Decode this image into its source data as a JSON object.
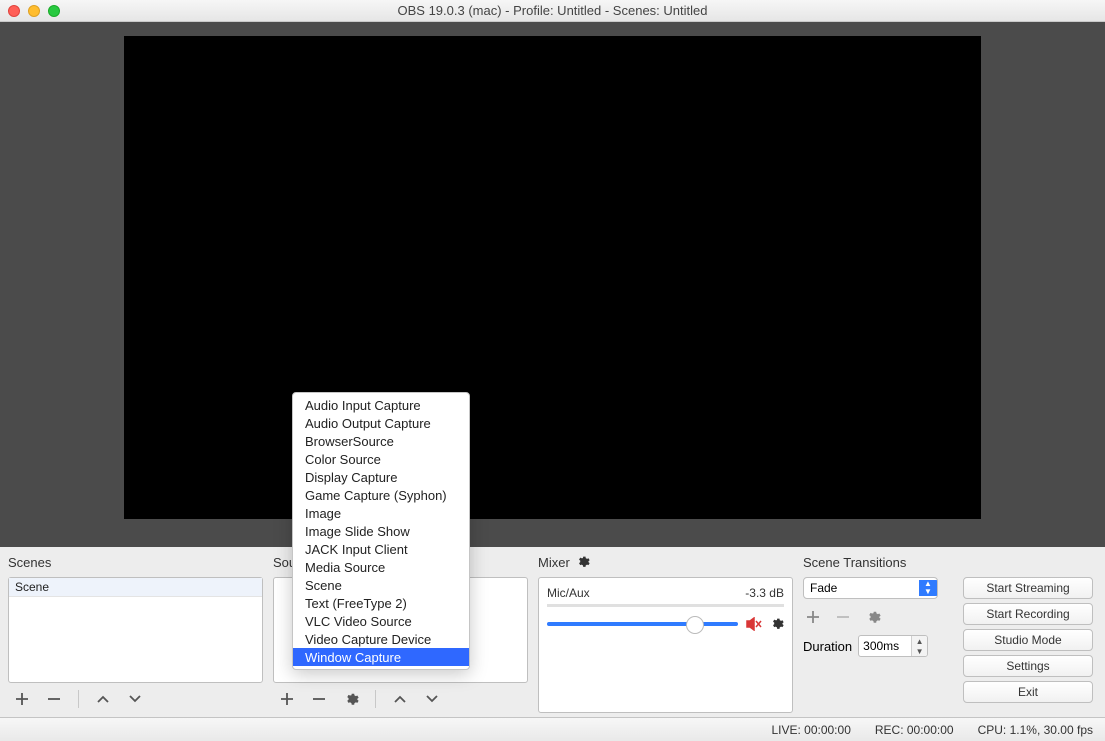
{
  "window_title": "OBS 19.0.3 (mac) - Profile: Untitled - Scenes: Untitled",
  "panels": {
    "scenes": {
      "label": "Scenes",
      "items": [
        "Scene"
      ]
    },
    "sources": {
      "label": "Sources"
    },
    "mixer": {
      "label": "Mixer",
      "channel_name": "Mic/Aux",
      "channel_level": "-3.3 dB"
    },
    "transitions": {
      "label": "Scene Transitions",
      "selected": "Fade",
      "duration_label": "Duration",
      "duration_value": "300ms"
    }
  },
  "buttons": {
    "start_streaming": "Start Streaming",
    "start_recording": "Start Recording",
    "studio_mode": "Studio Mode",
    "settings": "Settings",
    "exit": "Exit"
  },
  "status": {
    "live": "LIVE: 00:00:00",
    "rec": "REC: 00:00:00",
    "cpu": "CPU: 1.1%, 30.00 fps"
  },
  "popup": {
    "items": [
      "Audio Input Capture",
      "Audio Output Capture",
      "BrowserSource",
      "Color Source",
      "Display Capture",
      "Game Capture (Syphon)",
      "Image",
      "Image Slide Show",
      "JACK Input Client",
      "Media Source",
      "Scene",
      "Text (FreeType 2)",
      "VLC Video Source",
      "Video Capture Device",
      "Window Capture"
    ],
    "selected_index": 14
  }
}
